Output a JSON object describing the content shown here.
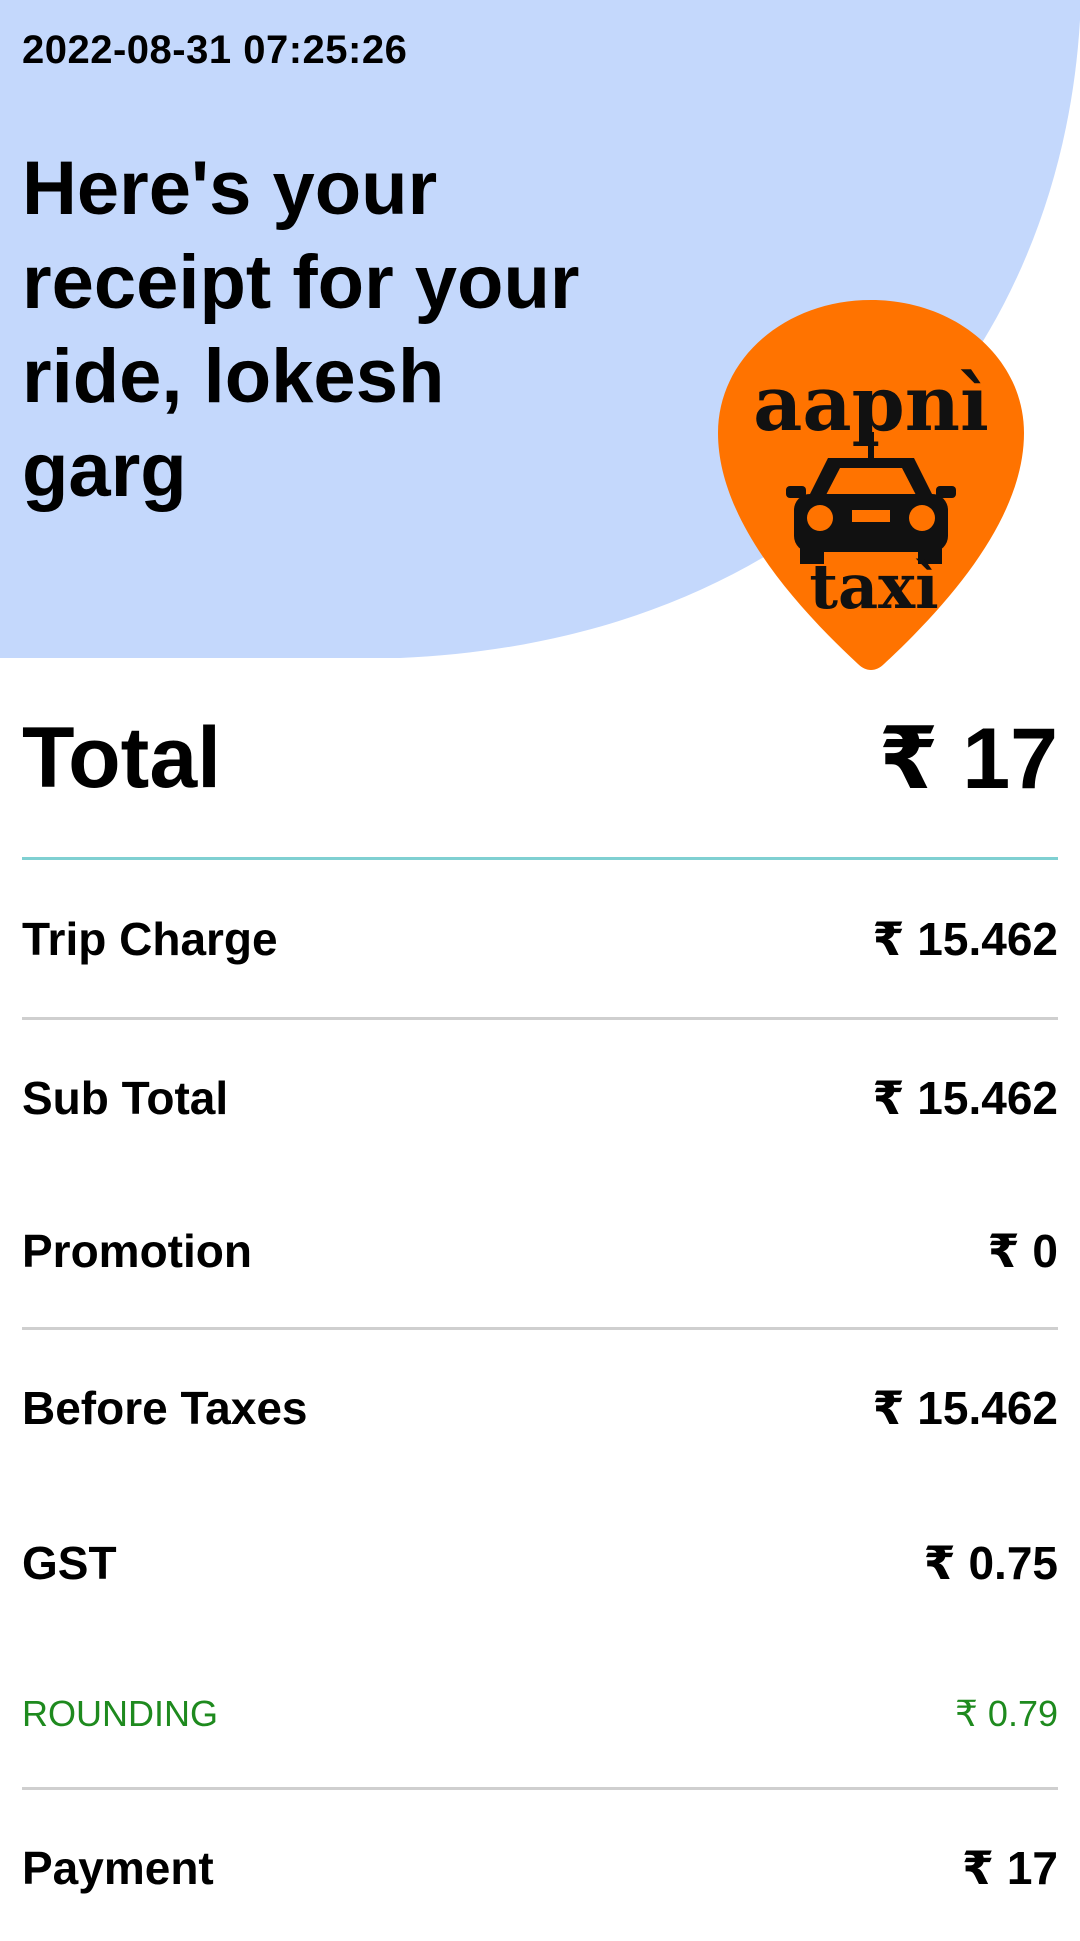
{
  "colors": {
    "header_background": "#c4d8fc",
    "logo_pin": "#ff7300",
    "total_divider": "#7fd0d2",
    "row_divider": "#cfcfcf",
    "rounding_text": "#1e8a1e"
  },
  "header": {
    "timestamp": "2022-08-31 07:25:26",
    "headline": "Here's your receipt for your ride, lokesh garg"
  },
  "logo": {
    "icon": "aapni-taxi-logo-icon",
    "top_text": "aapnì",
    "bottom_text": "taxì"
  },
  "total": {
    "label": "Total",
    "value": "₹ 17"
  },
  "rows": [
    {
      "label": "Trip Charge",
      "value": "₹ 15.462"
    },
    {
      "label": "Sub Total",
      "value": "₹ 15.462"
    },
    {
      "label": "Promotion",
      "value": "₹ 0"
    },
    {
      "label": "Before Taxes",
      "value": "₹ 15.462"
    },
    {
      "label": "GST",
      "value": "₹ 0.75"
    },
    {
      "label": "ROUNDING",
      "value": "₹ 0.79"
    },
    {
      "label": "Payment",
      "value": "₹ 17"
    }
  ]
}
